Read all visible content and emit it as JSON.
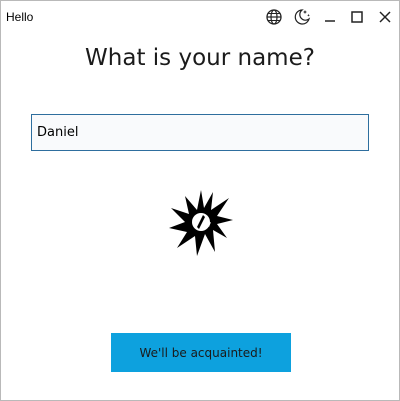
{
  "window": {
    "title": "Hello",
    "controls": {
      "language_icon": "globe-icon",
      "theme_icon": "moon-stars-icon",
      "minimize_icon": "minimize-icon",
      "maximize_icon": "maximize-icon",
      "close_icon": "close-icon"
    }
  },
  "main": {
    "heading": "What is your name?",
    "name_input": {
      "value": "Daniel"
    },
    "logo_icon": "spiky-burst-logo",
    "submit_label": "We'll be acquainted!"
  },
  "colors": {
    "accent": "#0da1de",
    "input_border": "#2e6e9e"
  }
}
